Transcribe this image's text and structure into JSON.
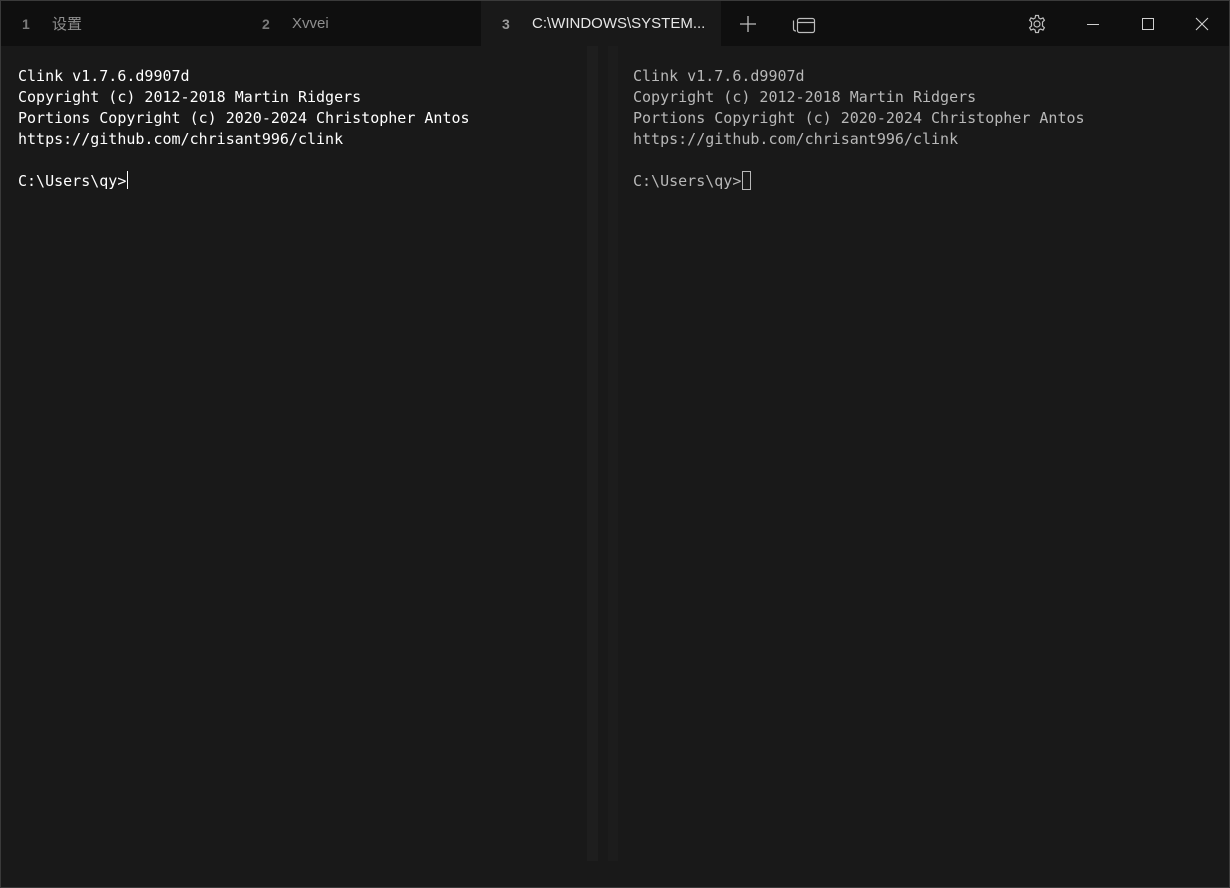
{
  "tabs": [
    {
      "number": "1",
      "title": "设置",
      "active": false
    },
    {
      "number": "2",
      "title": "Xvvei",
      "active": false
    },
    {
      "number": "3",
      "title": "C:\\WINDOWS\\SYSTEM...",
      "active": true
    }
  ],
  "toolbar": {
    "new_tab_icon": "plus-icon",
    "dropdown_icon": "tab-menu-icon",
    "settings_icon": "gear-icon",
    "minimize_icon": "minimize-icon",
    "maximize_icon": "maximize-icon",
    "close_icon": "close-icon"
  },
  "panes": {
    "left": {
      "lines": [
        "Clink v1.7.6.d9907d",
        "Copyright (c) 2012-2018 Martin Ridgers",
        "Portions Copyright (c) 2020-2024 Christopher Antos",
        "https://github.com/chrisant996/clink",
        "",
        "C:\\Users\\qy>"
      ],
      "cursor": "bar"
    },
    "right": {
      "lines": [
        "Clink v1.7.6.d9907d",
        "Copyright (c) 2012-2018 Martin Ridgers",
        "Portions Copyright (c) 2020-2024 Christopher Antos",
        "https://github.com/chrisant996/clink",
        "",
        "C:\\Users\\qy>"
      ],
      "cursor": "box"
    }
  },
  "colors": {
    "titlebar_bg": "#0f0f0f",
    "terminal_bg": "#191919",
    "focused_text": "#ffffff",
    "unfocused_text": "#b8b8b8"
  }
}
